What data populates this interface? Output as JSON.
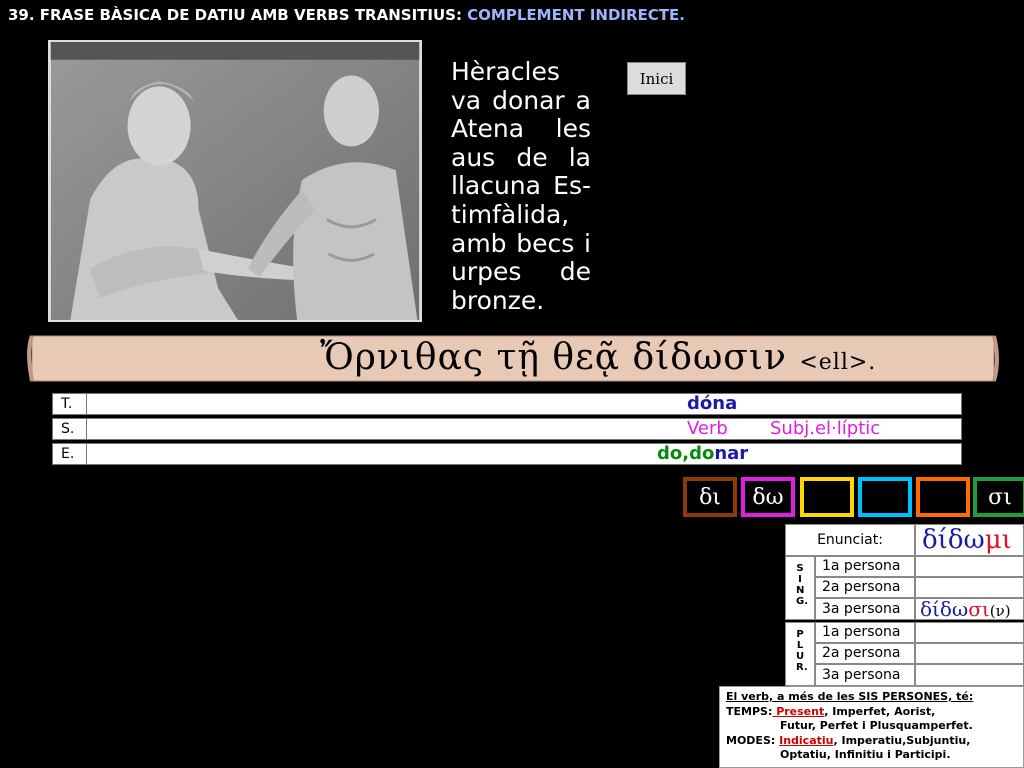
{
  "title": {
    "part1": "39. FRASE BÀSICA DE DATIU AMB VERBS TRANSITIUS: ",
    "part2": "COMPLEMENT INDIRECTE."
  },
  "narrative": "Hèracles va donar a Atena les aus de la llacuna Es-timfàlida, amb becs i urpes de bronze.",
  "inici_label": "Inici",
  "greek": {
    "sentence": "Ὄρνιθας τῇ θεᾷ δίδωσιν ",
    "ell": "<ell>."
  },
  "analysis": {
    "rows": [
      {
        "label": "T.",
        "value": "dóna"
      },
      {
        "label": "S.",
        "verb": "Verb",
        "subject": "Subj.el·líptic"
      },
      {
        "label": "E.",
        "part1": "do,do",
        "part2": "nar"
      }
    ]
  },
  "keys": [
    {
      "text": "δι",
      "color": "#8b3a0e"
    },
    {
      "text": "δω",
      "color": "#e020e0"
    },
    {
      "text": "",
      "color": "#ffd700"
    },
    {
      "text": "",
      "color": "#00bfff"
    },
    {
      "text": "",
      "color": "#ff6a00"
    },
    {
      "text": "σι",
      "color": "#1f9e3a"
    }
  ],
  "conjugation": {
    "header_label": "Enunciat:",
    "header_value_stem": "δίδω",
    "header_value_ending": "μι",
    "sing_label": "SING.",
    "plur_label": "PLUR.",
    "persons": [
      "1a persona",
      "2a persona",
      "3a persona"
    ],
    "third_sing_stem": "δίδω",
    "third_sing_ending": "σι",
    "third_sing_nu": "(ν)"
  },
  "notes": {
    "line1": "El verb, a més de les SIS PERSONES, té:",
    "temps_label": "TEMPS:",
    "temps_highlight": " Present",
    "temps_rest": ", Imperfet, Aorist,",
    "temps_line2": "Futur, Perfet i Plusquamperfet.",
    "modes_label": "MODES:",
    "modes_highlight": "Indicatiu",
    "modes_rest": ", Imperatiu,Subjuntiu,",
    "modes_line2": "Optatiu, Infinitiu i Participi."
  },
  "colors": {
    "blue": "#1a1aa6",
    "red": "#e0102a",
    "magenta": "#e020e0",
    "green": "#0a8a0a"
  }
}
